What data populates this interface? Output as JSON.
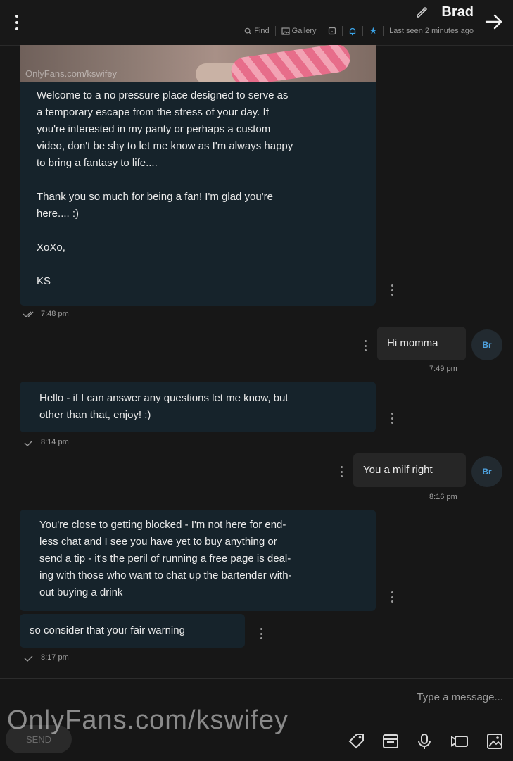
{
  "header": {
    "title": "Brad",
    "last_seen": "Last seen 2 minutes ago",
    "gallery_label": "Gallery",
    "find_label": "Find"
  },
  "messages": [
    {
      "from": "creator",
      "photo_watermark": "OnlyFans.com/kswifey",
      "text": "Welcome to a no pressure place designed to serve as\na temporary escape from the stress of your day. If\nyou're interested in my panty or perhaps a custom\nvideo, don't be shy to let me know as I'm always happy\nto bring a fantasy to life....\n\nThank you so much for being a fan! I'm glad you're\nhere.... :)\n\nXoXo,\n\nKS",
      "time": "7:48 pm"
    },
    {
      "from": "fan",
      "avatar": "Br",
      "text": "Hi momma",
      "time": "7:49 pm"
    },
    {
      "from": "creator",
      "text": "Hello - if I can answer any questions let me know, but\nother than that, enjoy! :)",
      "time": "8:14 pm"
    },
    {
      "from": "fan",
      "avatar": "Br",
      "text": "You a milf right",
      "time": "8:16 pm"
    },
    {
      "from": "creator",
      "text": "You're close to getting blocked - I'm not here for end-\nless chat and I see you have yet to buy anything or\nsend a tip - it's the peril of running a free page is deal-\ning with those who want to chat up the bartender with-\nout buying a drink",
      "time": ""
    },
    {
      "from": "creator",
      "text": "so consider that your fair warning",
      "time": "8:17 pm"
    }
  ],
  "composer": {
    "placeholder": "Type a message...",
    "send_label": "SEND"
  },
  "watermark": "OnlyFans.com/kswifey",
  "colors": {
    "background": "#171717",
    "outgoing_bubble": "#16232b",
    "incoming_bubble": "#262626",
    "accent": "#3aa3e6"
  }
}
